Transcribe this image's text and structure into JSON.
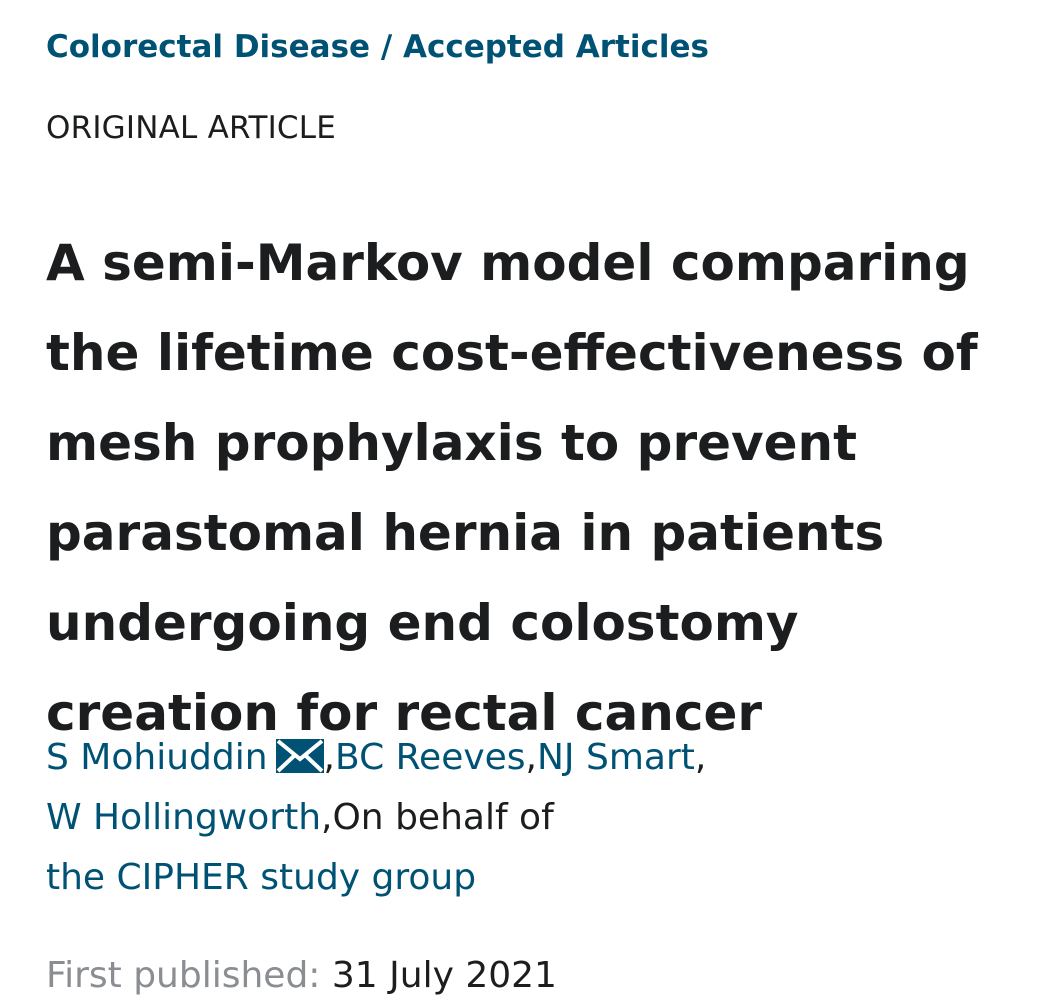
{
  "breadcrumb": {
    "journal": "Colorectal Disease",
    "separator": " / ",
    "section": "Accepted Articles"
  },
  "article_type": "ORIGINAL ARTICLE",
  "title": "A semi-Markov model comparing the lifetime cost-effectiveness of mesh prophylaxis to prevent parastomal hernia in patients undergoing end colostomy creation for rectal cancer",
  "authors": {
    "list": [
      "S Mohiuddin",
      "BC Reeves",
      "NJ Smart",
      "W Hollingworth"
    ],
    "separator": ",",
    "group_prefix": "On behalf of",
    "group_name": "the CIPHER study group"
  },
  "icons": {
    "corresponding_author": "envelope-icon"
  },
  "colors": {
    "link": "#005274",
    "text": "#1c1d1e",
    "muted": "#8a8d91"
  },
  "published": {
    "label": "First published:",
    "date": "31 July 2021"
  }
}
